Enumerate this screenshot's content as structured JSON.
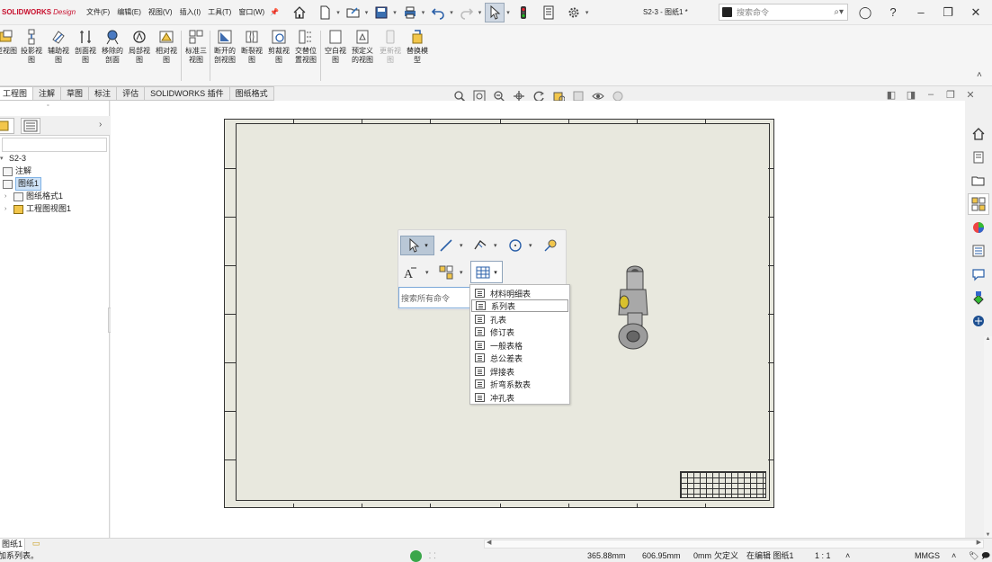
{
  "app": {
    "brand": "SOLIDWORKS",
    "edition": "Design",
    "document_title": "S2-3 - 图纸1 *"
  },
  "menu": [
    "文件(F)",
    "编辑(E)",
    "视图(V)",
    "插入(I)",
    "工具(T)",
    "窗口(W)"
  ],
  "search": {
    "placeholder": "搜索命令"
  },
  "ribbon": {
    "buttons": [
      {
        "label": "型视图",
        "icon": "model-view-icon"
      },
      {
        "label": "投影视图",
        "icon": "projected-view-icon"
      },
      {
        "label": "辅助视图",
        "icon": "auxiliary-view-icon"
      },
      {
        "label": "剖面视图",
        "icon": "section-view-icon"
      },
      {
        "label": "移除的剖面",
        "icon": "removed-section-icon"
      },
      {
        "label": "局部视图",
        "icon": "detail-view-icon"
      },
      {
        "label": "相对视图",
        "icon": "relative-view-icon"
      },
      {
        "label": "标准三视图",
        "icon": "standard-3-view-icon"
      },
      {
        "label": "断开的剖视图",
        "icon": "broken-out-section-icon"
      },
      {
        "label": "断裂视图",
        "icon": "break-view-icon"
      },
      {
        "label": "剪裁视图",
        "icon": "crop-view-icon"
      },
      {
        "label": "交替位置视图",
        "icon": "alternate-position-view-icon"
      },
      {
        "label": "空白视图",
        "icon": "empty-view-icon"
      },
      {
        "label": "预定义的视图",
        "icon": "predefined-view-icon"
      },
      {
        "label": "更新视图",
        "icon": "update-view-icon",
        "disabled": true
      },
      {
        "label": "替换模型",
        "icon": "replace-model-icon"
      }
    ]
  },
  "tabs": [
    "工程图",
    "注解",
    "草图",
    "标注",
    "评估",
    "SOLIDWORKS 插件",
    "图纸格式"
  ],
  "feature_tree": {
    "root": "S2-3",
    "items": [
      {
        "label": "注解",
        "icon": "annotations-icon",
        "expand": ""
      },
      {
        "label": "图纸1",
        "icon": "sheet-icon",
        "selected": true,
        "expand": ""
      },
      {
        "label": "图纸格式1",
        "icon": "sheet-format-icon",
        "expand": "›"
      },
      {
        "label": "工程图视图1",
        "icon": "drawing-view-icon",
        "expand": "›"
      }
    ]
  },
  "context_toolbar": {
    "search_placeholder": "搜索所有命令"
  },
  "table_menu": {
    "items": [
      "材料明细表",
      "系列表",
      "孔表",
      "修订表",
      "一般表格",
      "总公差表",
      "焊接表",
      "折弯系数表",
      "冲孔表"
    ],
    "hovered": "系列表"
  },
  "sheet_tab": {
    "label": "图纸1"
  },
  "status": {
    "message": "加系列表。",
    "x": "365.88mm",
    "y": "606.95mm",
    "z": "0mm",
    "definition": "欠定义",
    "mode": "在编辑 图纸1",
    "scale": "1 : 1",
    "units": "MMGS"
  },
  "colors": {
    "brand_red": "#c8102e",
    "sheet_bg": "#e8e8de",
    "selection_blue": "#cfe3f7",
    "pressed_btn": "#b9c7d6"
  }
}
